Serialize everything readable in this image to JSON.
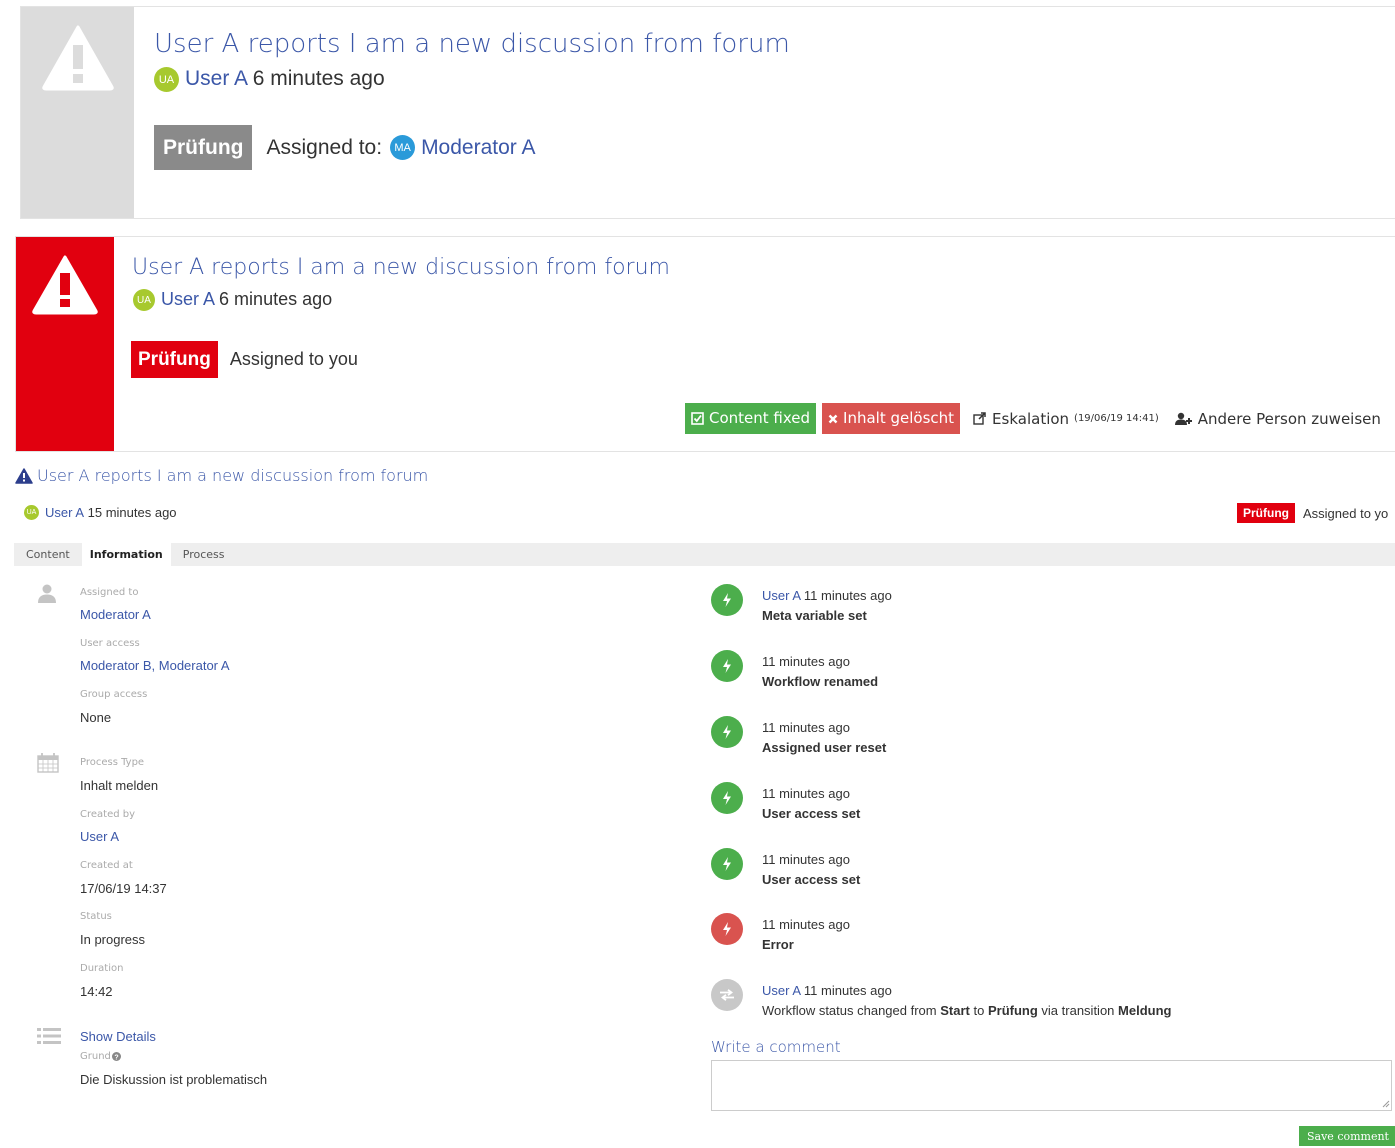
{
  "card1": {
    "title": "User A reports I am a new discussion from forum",
    "author_initials": "UA",
    "author": "User A",
    "time": "6 minutes ago",
    "status": "Prüfung",
    "assigned_prefix": "Assigned to:",
    "assignee_initials": "MA",
    "assignee": "Moderator A"
  },
  "card2": {
    "title": "User A reports I am a new discussion from forum",
    "author_initials": "UA",
    "author": "User A",
    "time": "6 minutes ago",
    "status": "Prüfung",
    "assigned_text": "Assigned to you",
    "actions": {
      "content_fixed": "Content fixed",
      "deleted": "Inhalt gelöscht",
      "escalation": "Eskalation",
      "escalation_date": "(19/06/19 14:41)",
      "reassign": "Andere Person zuweisen"
    },
    "colors": {
      "alert": "#e1000f",
      "success": "#4cae4c",
      "danger": "#d9534f"
    }
  },
  "detail": {
    "title": "User A reports I am a new discussion from forum",
    "author_initials": "UA",
    "author": "User A",
    "time": "15 minutes ago",
    "status": "Prüfung",
    "assigned_text": "Assigned to yo",
    "tabs": [
      "Content",
      "Information",
      "Process"
    ],
    "active_tab": "Information",
    "info": {
      "assigned_to_label": "Assigned to",
      "assigned_to": "Moderator A",
      "user_access_label": "User access",
      "user_access": "Moderator B, Moderator A",
      "group_access_label": "Group access",
      "group_access": "None",
      "process_type_label": "Process Type",
      "process_type": "Inhalt melden",
      "created_by_label": "Created by",
      "created_by": "User A",
      "created_at_label": "Created at",
      "created_at": "17/06/19 14:37",
      "status_label": "Status",
      "status": "In progress",
      "duration_label": "Duration",
      "duration": "14:42",
      "show_details": "Show Details",
      "reason_label": "Grund",
      "reason": "Die Diskussion ist problematisch"
    },
    "activity": [
      {
        "user": "User A",
        "time": "11 minutes ago",
        "text": "Meta variable set",
        "type": "success",
        "icon": "bolt-icon"
      },
      {
        "user": "",
        "time": "11 minutes ago",
        "text": "Workflow renamed",
        "type": "success",
        "icon": "bolt-icon"
      },
      {
        "user": "",
        "time": "11 minutes ago",
        "text": "Assigned user reset",
        "type": "success",
        "icon": "bolt-icon"
      },
      {
        "user": "",
        "time": "11 minutes ago",
        "text": "User access set",
        "type": "success",
        "icon": "bolt-icon"
      },
      {
        "user": "",
        "time": "11 minutes ago",
        "text": "User access set",
        "type": "success",
        "icon": "bolt-icon"
      },
      {
        "user": "",
        "time": "11 minutes ago",
        "text": "Error",
        "type": "error",
        "icon": "bolt-icon"
      }
    ],
    "transition": {
      "user": "User A",
      "time": "11 minutes ago",
      "prefix": "Workflow status changed from",
      "from": "Start",
      "to_word": "to",
      "to": "Prüfung",
      "via_word": "via transition",
      "transition": "Meldung"
    },
    "comment_label": "Write a comment",
    "comment_value": "",
    "save_label": "Save comment"
  }
}
